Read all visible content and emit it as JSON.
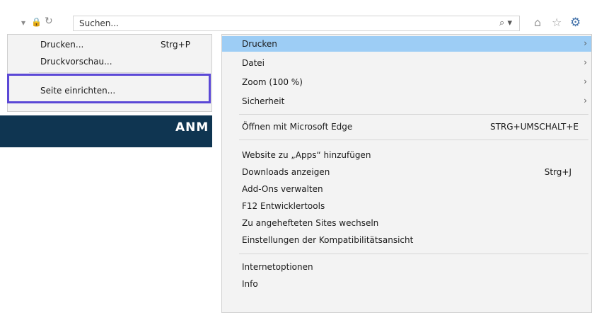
{
  "toolbar": {
    "search_placeholder": "Suchen...",
    "search_glyph": "⌕ ▾",
    "back_glyph": "▾",
    "lock_glyph": "🔒",
    "refresh_glyph": "↻"
  },
  "page": {
    "banner_text": "ANM"
  },
  "print_submenu": {
    "items": [
      {
        "label": "Drucken...",
        "shortcut": "Strg+P"
      },
      {
        "label": "Druckvorschau..."
      },
      {
        "label": "Seite einrichten..."
      }
    ]
  },
  "tools_menu": {
    "items": [
      {
        "label": "Drucken",
        "arrow": "›"
      },
      {
        "label": "Datei",
        "arrow": "›"
      },
      {
        "label": "Zoom (100 %)",
        "arrow": "›"
      },
      {
        "label": "Sicherheit",
        "arrow": "›"
      },
      {
        "label": "Öffnen mit Microsoft Edge",
        "shortcut": "STRG+UMSCHALT+E"
      },
      {
        "label": "Website zu „Apps“ hinzufügen"
      },
      {
        "label": "Downloads anzeigen",
        "shortcut": "Strg+J"
      },
      {
        "label": "Add-Ons verwalten"
      },
      {
        "label": "F12 Entwicklertools"
      },
      {
        "label": "Zu angehefteten Sites wechseln"
      },
      {
        "label": "Einstellungen der Kompatibilitätsansicht"
      },
      {
        "label": "Internetoptionen"
      },
      {
        "label": "Info"
      }
    ]
  },
  "colors": {
    "menu_highlight": "#9dcdf5",
    "banner": "#0f3551",
    "focus_box": "#5b48d6",
    "gear": "#3f6fa8"
  }
}
